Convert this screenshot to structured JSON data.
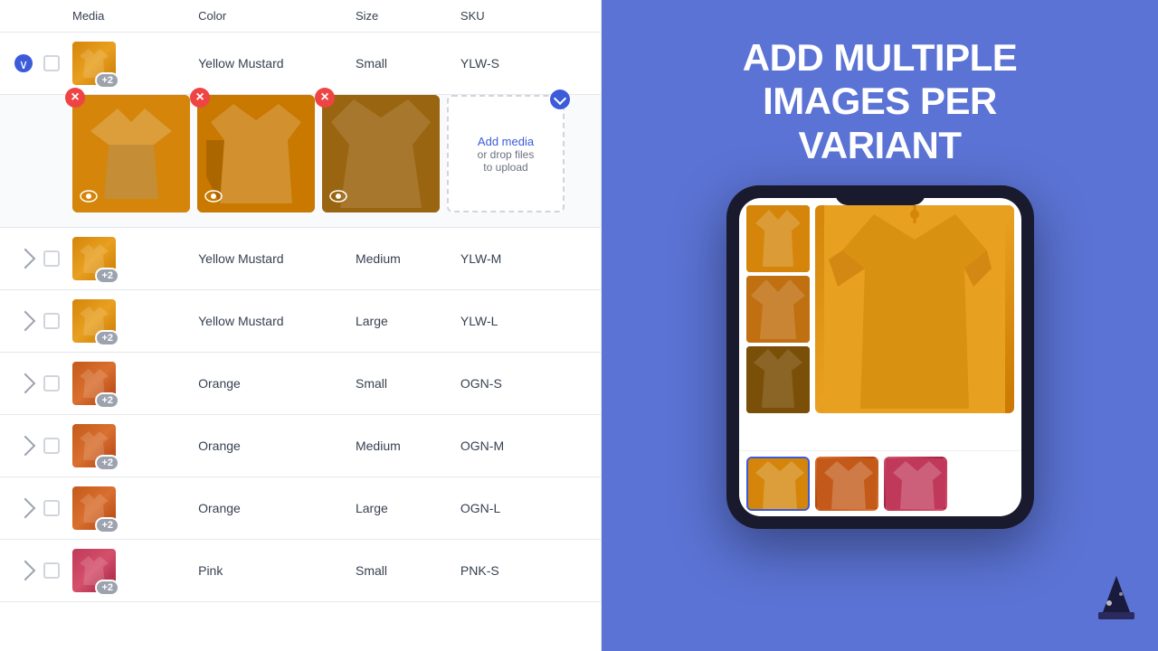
{
  "header": {
    "expand_col": "",
    "check_col": "",
    "media_col": "Media",
    "color_col": "Color",
    "size_col": "Size",
    "sku_col": "SKU"
  },
  "expanded_row": {
    "color": "Yellow Mustard",
    "size": "Small",
    "sku": "YLW-S",
    "images_count": 3
  },
  "variants": [
    {
      "id": "ylw-s",
      "color": "Yellow Mustard",
      "size": "Small",
      "sku": "YLW-S",
      "shirt_class": "shirt-yellow",
      "badge": "+2",
      "expanded": true
    },
    {
      "id": "ylw-m",
      "color": "Yellow Mustard",
      "size": "Medium",
      "sku": "YLW-M",
      "shirt_class": "shirt-yellow",
      "badge": "+2",
      "expanded": false
    },
    {
      "id": "ylw-l",
      "color": "Yellow Mustard",
      "size": "Large",
      "sku": "YLW-L",
      "shirt_class": "shirt-yellow",
      "badge": "+2",
      "expanded": false
    },
    {
      "id": "ogn-s",
      "color": "Orange",
      "size": "Small",
      "sku": "OGN-S",
      "shirt_class": "shirt-orange",
      "badge": "+2",
      "expanded": false
    },
    {
      "id": "ogn-m",
      "color": "Orange",
      "size": "Medium",
      "sku": "OGN-M",
      "shirt_class": "shirt-orange",
      "badge": "+2",
      "expanded": false
    },
    {
      "id": "ogn-l",
      "color": "Orange",
      "size": "Large",
      "sku": "OGN-L",
      "shirt_class": "shirt-orange",
      "badge": "+2",
      "expanded": false
    },
    {
      "id": "pnk-s",
      "color": "Pink",
      "size": "Small",
      "sku": "PNK-S",
      "shirt_class": "shirt-pink",
      "badge": "+2",
      "expanded": false
    }
  ],
  "add_media": {
    "label": "Add media",
    "sublabel": "or drop files",
    "sublabel2": "to upload"
  },
  "right_panel": {
    "title_line1": "ADD MULTIPLE",
    "title_line2": "IMAGES PER",
    "title_line3": "VARIANT"
  }
}
